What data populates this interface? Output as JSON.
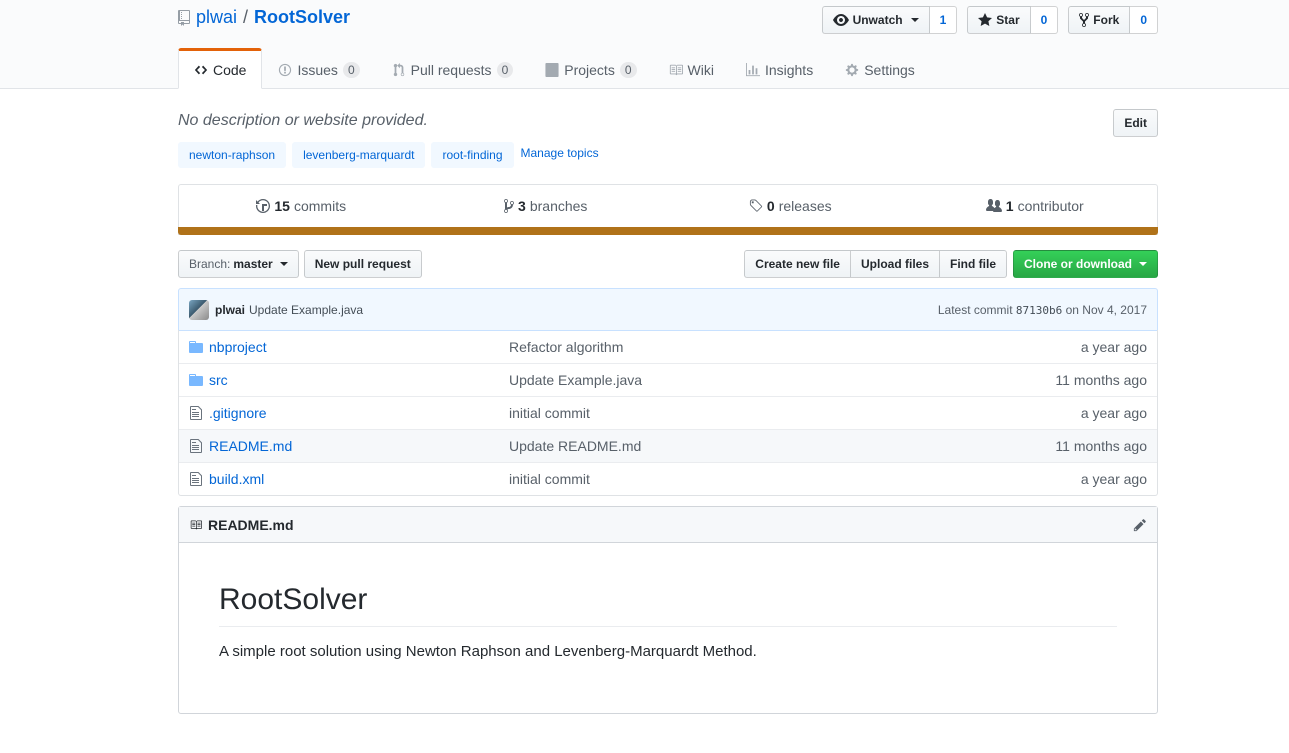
{
  "repo": {
    "owner": "plwai",
    "separator": "/",
    "name": "RootSolver"
  },
  "actions": {
    "watch": {
      "label": "Unwatch",
      "count": "1"
    },
    "star": {
      "label": "Star",
      "count": "0"
    },
    "fork": {
      "label": "Fork",
      "count": "0"
    }
  },
  "nav": {
    "code": "Code",
    "issues": "Issues",
    "issues_count": "0",
    "pulls": "Pull requests",
    "pulls_count": "0",
    "projects": "Projects",
    "projects_count": "0",
    "wiki": "Wiki",
    "insights": "Insights",
    "settings": "Settings"
  },
  "description": "No description or website provided.",
  "edit_label": "Edit",
  "topics": [
    "newton-raphson",
    "levenberg-marquardt",
    "root-finding"
  ],
  "manage_topics": "Manage topics",
  "summary": {
    "commits_num": "15",
    "commits_label": "commits",
    "branches_num": "3",
    "branches_label": "branches",
    "releases_num": "0",
    "releases_label": "releases",
    "contributors_num": "1",
    "contributors_label": "contributor"
  },
  "language_color": "#b07219",
  "file_nav": {
    "branch_prefix": "Branch:",
    "branch": "master",
    "new_pr": "New pull request",
    "create_file": "Create new file",
    "upload_files": "Upload files",
    "find_file": "Find file",
    "clone": "Clone or download"
  },
  "latest_commit": {
    "author": "plwai",
    "message": "Update Example.java",
    "prefix": "Latest commit",
    "sha": "87130b6",
    "date": "on Nov 4, 2017"
  },
  "files": [
    {
      "name": "nbproject",
      "type": "folder",
      "message": "Refactor algorithm",
      "age": "a year ago"
    },
    {
      "name": "src",
      "type": "folder",
      "message": "Update Example.java",
      "age": "11 months ago"
    },
    {
      "name": ".gitignore",
      "type": "file",
      "message": "initial commit",
      "age": "a year ago"
    },
    {
      "name": "README.md",
      "type": "file",
      "message": "Update README.md",
      "age": "11 months ago"
    },
    {
      "name": "build.xml",
      "type": "file",
      "message": "initial commit",
      "age": "a year ago"
    }
  ],
  "readme": {
    "filename": "README.md",
    "heading": "RootSolver",
    "body": "A simple root solution using Newton Raphson and Levenberg-Marquardt Method."
  }
}
